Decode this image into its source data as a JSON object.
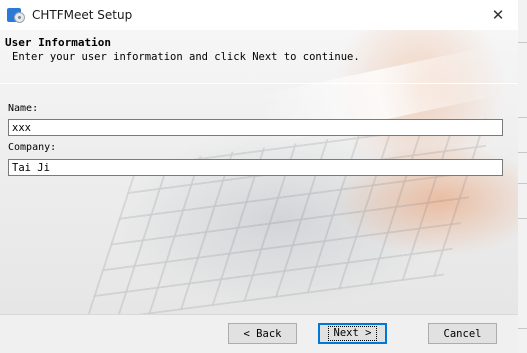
{
  "window": {
    "title": "CHTFMeet Setup",
    "close_glyph": "✕",
    "icon": "setup-cd-icon"
  },
  "header": {
    "title": "User Information",
    "description": "Enter your user information and click Next to continue."
  },
  "form": {
    "name_label": "Name:",
    "name_value": "xxx",
    "company_label": "Company:",
    "company_value": "Tai Ji"
  },
  "buttons": {
    "back": "< Back",
    "next": "Next >",
    "cancel": "Cancel"
  },
  "colors": {
    "default_button_border": "#0078d7",
    "dialog_background": "#f0f0f0"
  }
}
